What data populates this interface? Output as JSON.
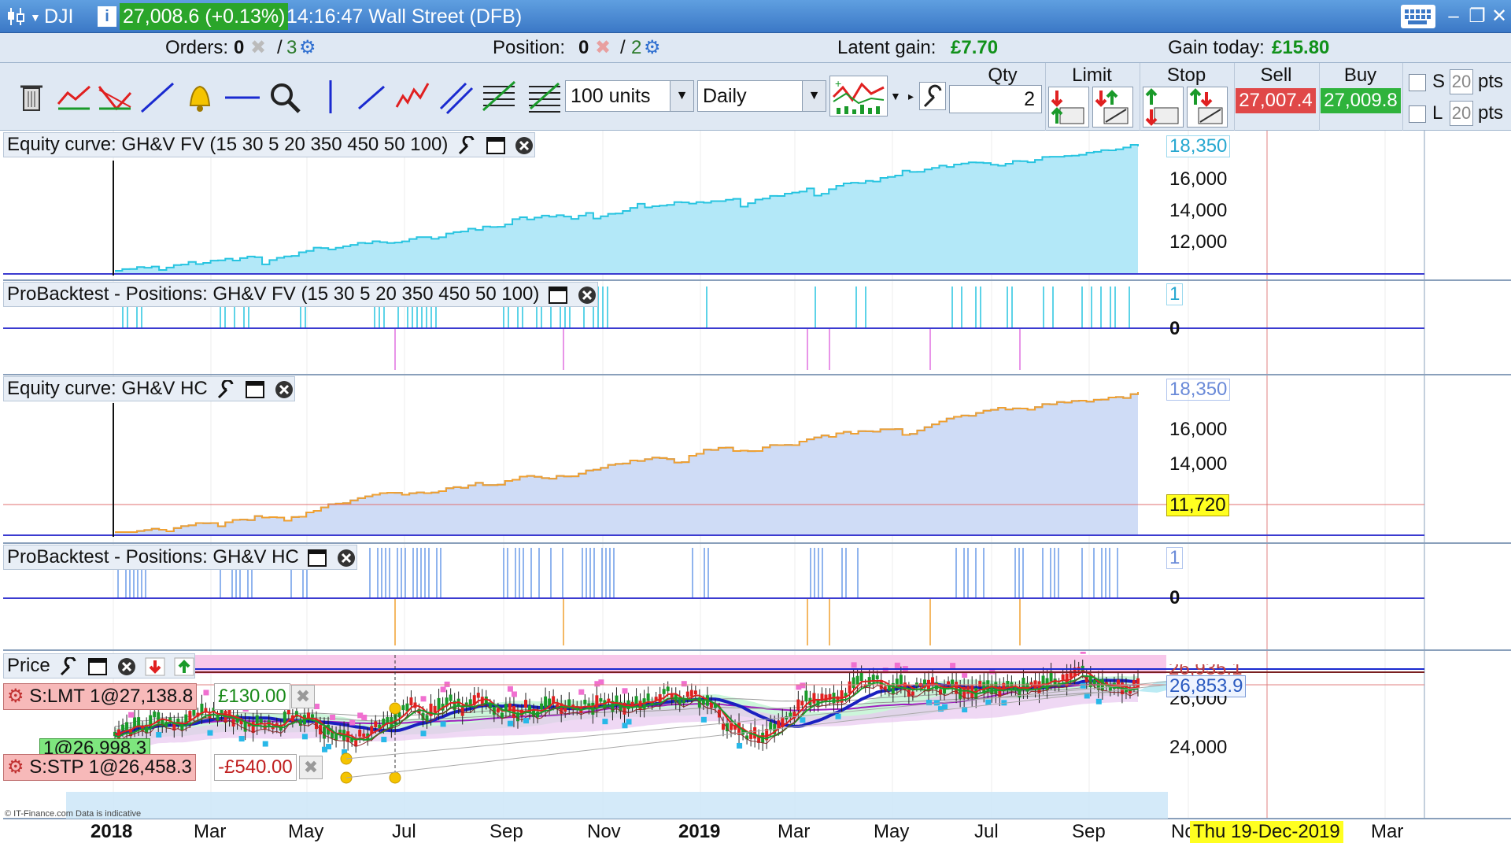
{
  "titlebar": {
    "symbol": "DJI",
    "info_icon": "info-icon",
    "price": "27,008.6 (+0.13%)",
    "time_market": "14:16:47 Wall Street (DFB)"
  },
  "topinfo": {
    "orders_label": "Orders:",
    "orders_value": "0",
    "orders_sep": "/",
    "orders_auto": "3",
    "position_label": "Position:",
    "position_value": "0",
    "position_sep": "/",
    "position_auto": "2",
    "latent_label": "Latent gain:",
    "latent_value": "£7.70",
    "gain_today_label": "Gain today:",
    "gain_today_value": "£15.80"
  },
  "toolbar": {
    "units_select": "100 units",
    "period_select": "Daily",
    "qty_label": "Qty",
    "qty_value": "2",
    "limit_label": "Limit",
    "stop_label": "Stop",
    "sell_label": "Sell",
    "buy_label": "Buy",
    "sell_price": "27,007.4",
    "buy_price": "27,009.8",
    "s_label": "S",
    "l_label": "L",
    "s_pts_value": "20",
    "l_pts_value": "20",
    "pts_label": "pts"
  },
  "panels": {
    "equity_fv_title": "Equity curve: GH&V FV (15 30 5 20 350 450 50 100)",
    "positions_fv_title": "ProBacktest - Positions: GH&V FV (15 30 5 20 350 450 50 100)",
    "equity_hc_title": "Equity curve: GH&V HC",
    "positions_hc_title": "ProBacktest - Positions: GH&V HC",
    "price_title": "Price"
  },
  "axes": {
    "eq_fv_tag": "18,350",
    "eq_fv_ticks": [
      "16,000",
      "14,000",
      "12,000"
    ],
    "pos_fv_tag": "1",
    "pos_fv_zero": "0",
    "eq_hc_tag": "18,350",
    "eq_hc_ticks": [
      "16,000",
      "14,000"
    ],
    "eq_hc_marker": "11,720",
    "pos_hc_tag": "1",
    "pos_hc_zero": "0",
    "price_tag_current": "26,853.9",
    "price_tag_top": "26,935.1",
    "price_ticks": [
      "26,000",
      "24,000"
    ]
  },
  "orders_on_chart": {
    "lmt_label": "S:LMT 1@27,138.8",
    "lmt_gain": "£130.00",
    "pos_label": "1@26,998.3",
    "stp_label": "S:STP 1@26,458.3",
    "stp_loss": "-£540.00"
  },
  "xaxis": {
    "months": [
      "2018",
      "Mar",
      "May",
      "Jul",
      "Sep",
      "Nov",
      "2019",
      "Mar",
      "May",
      "Jul",
      "Sep",
      "No",
      "Mar"
    ],
    "crosshair_date": "Thu 19-Dec-2019"
  },
  "footer": {
    "copyright": "© IT-Finance.com  Data is indicative"
  },
  "colors": {
    "title_blue": "#3b78c6",
    "gain_green": "#2aa52a",
    "sell_red": "#e04848",
    "buy_green": "#2fb33c",
    "fv_fill": "#b3e8f8",
    "hc_fill": "#cfdcf6",
    "hc_line": "#f0a030",
    "fv_line": "#27c4e0"
  }
}
